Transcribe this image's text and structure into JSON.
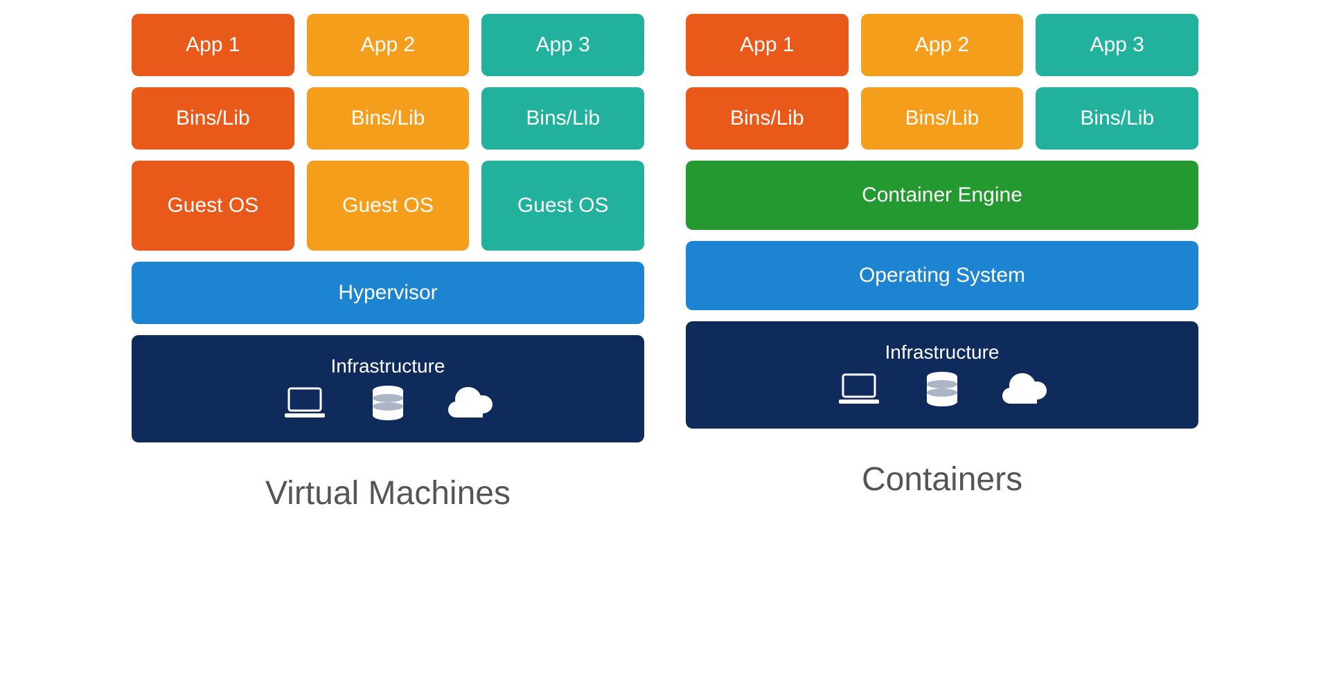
{
  "vm": {
    "apps": [
      "App 1",
      "App 2",
      "App 3"
    ],
    "bins": [
      "Bins/Lib",
      "Bins/Lib",
      "Bins/Lib"
    ],
    "guest": [
      "Guest OS",
      "Guest OS",
      "Guest OS"
    ],
    "hypervisor": "Hypervisor",
    "infrastructure": "Infrastructure",
    "caption": "Virtual Machines"
  },
  "containers": {
    "apps": [
      "App 1",
      "App 2",
      "App 3"
    ],
    "bins": [
      "Bins/Lib",
      "Bins/Lib",
      "Bins/Lib"
    ],
    "engine": "Container Engine",
    "os": "Operating System",
    "infrastructure": "Infrastructure",
    "caption": "Containers"
  },
  "colors": {
    "red": "#E8591A",
    "orange": "#F59E1B",
    "teal": "#22B19C",
    "blue": "#1C84D0",
    "navy": "#0F2B5C",
    "green": "#23992F"
  }
}
